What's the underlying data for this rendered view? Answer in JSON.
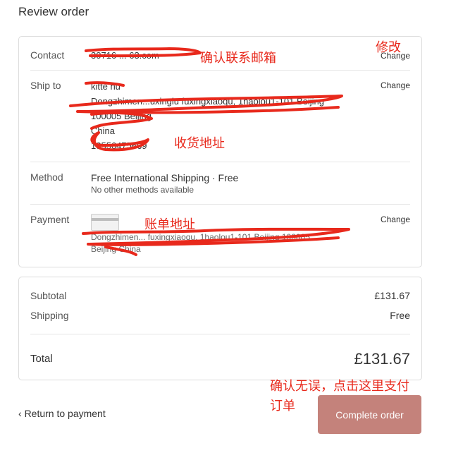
{
  "page": {
    "title": "Review order"
  },
  "contact": {
    "label": "Contact",
    "value": "30716 ... 63.com",
    "change": "Change"
  },
  "ship_to": {
    "label": "Ship to",
    "change": "Change",
    "lines": [
      "kitte hu",
      "Dongzhimen...uxinglu fuxingxiaoqu, 1haolou1-101 Beijing",
      "100005 Beijing",
      "China",
      "13556475669"
    ]
  },
  "method": {
    "label": "Method",
    "value": "Free International Shipping · Free",
    "note": "No other methods available"
  },
  "payment": {
    "label": "Payment",
    "change": "Change",
    "address": "Dongzhimen... fuxingxiaoqu, 1haolou1-101 Beijing 100005",
    "city": "Beijing  China"
  },
  "summary": {
    "subtotal_label": "Subtotal",
    "subtotal": "£131.67",
    "shipping_label": "Shipping",
    "shipping": "Free",
    "total_label": "Total",
    "total": "£131.67"
  },
  "footer": {
    "return_label": "Return to payment",
    "complete_label": "Complete order"
  },
  "annotations": {
    "confirm_email": "确认联系邮箱",
    "modify": "修改",
    "shipping_address": "收货地址",
    "billing_address": "账单地址",
    "confirm_pay_line1": "确认无误，点击这里支付",
    "confirm_pay_line2": "订单"
  },
  "colors": {
    "annotation": "#e8291c",
    "button": "#c4827b"
  }
}
